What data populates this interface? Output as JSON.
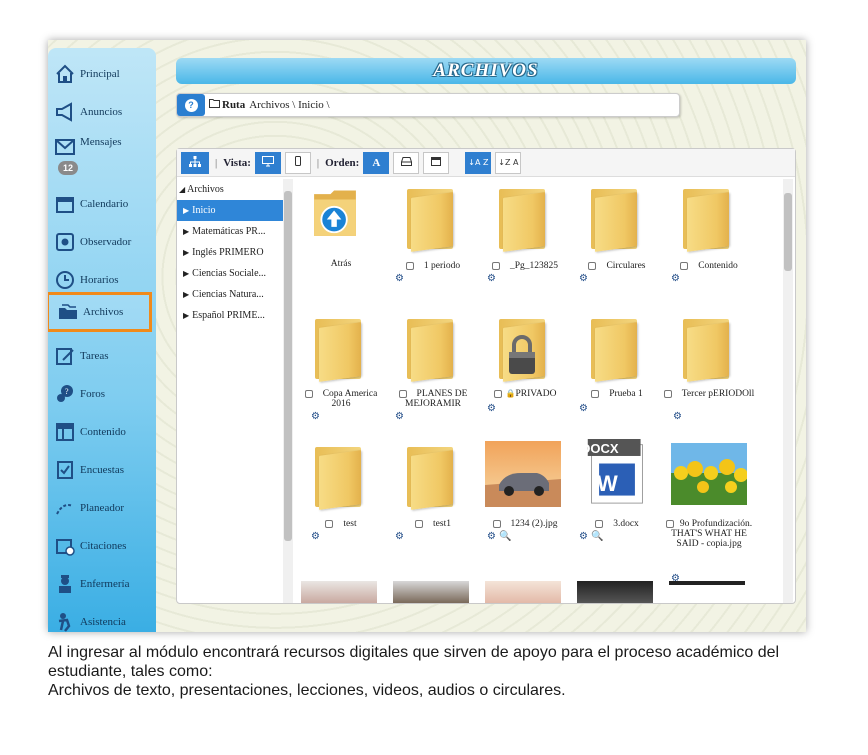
{
  "sidebar": {
    "items": [
      {
        "label": "Principal",
        "icon": "home-icon"
      },
      {
        "label": "Anuncios",
        "icon": "megaphone-icon"
      },
      {
        "label": "Mensajes",
        "icon": "envelope-icon"
      },
      {
        "label": "Calendario",
        "icon": "calendar-icon"
      },
      {
        "label": "Observador",
        "icon": "observer-icon"
      },
      {
        "label": "Horarios",
        "icon": "clock-icon"
      },
      {
        "label": "Archivos",
        "icon": "folders-icon"
      },
      {
        "label": "Tareas",
        "icon": "tasks-icon"
      },
      {
        "label": "Foros",
        "icon": "forum-icon"
      },
      {
        "label": "Contenido",
        "icon": "content-icon"
      },
      {
        "label": "Encuestas",
        "icon": "survey-icon"
      },
      {
        "label": "Planeador",
        "icon": "planner-icon"
      },
      {
        "label": "Citaciones",
        "icon": "citation-icon"
      },
      {
        "label": "Enfermería",
        "icon": "nurse-icon"
      },
      {
        "label": "Asistencia",
        "icon": "attendance-icon"
      }
    ],
    "messages_badge": "12",
    "active_color": "#f08a1a"
  },
  "header": {
    "title": "ARCHIVOS"
  },
  "breadcrumb": {
    "help": "?",
    "label": "Ruta",
    "path": "Archivos \\ Inicio \\"
  },
  "toolbar": {
    "view_label": "Vista:",
    "order_label": "Orden:",
    "order_alpha": "A",
    "sort_asc": "↓A Z",
    "sort_desc": "↓Z A"
  },
  "tree": {
    "root": "Archivos",
    "items": [
      "Inicio",
      "Matemáticas PR...",
      "Inglés PRIMERO",
      "Ciencias Sociale...",
      "Ciencias Natura...",
      "Español PRIME..."
    ],
    "selected": "Inicio"
  },
  "files": [
    {
      "name": "Atrás",
      "kind": "back"
    },
    {
      "name": "1 periodo",
      "kind": "folder"
    },
    {
      "name": "_Pg_123825",
      "kind": "folder"
    },
    {
      "name": "Circulares",
      "kind": "folder"
    },
    {
      "name": "Contenido",
      "kind": "folder"
    },
    {
      "name": "Copa America 2016",
      "kind": "folder"
    },
    {
      "name": "PLANES DE MEJORAMIR",
      "kind": "folder"
    },
    {
      "name": "PRIVADO",
      "kind": "locked"
    },
    {
      "name": "Prueba 1",
      "kind": "folder"
    },
    {
      "name": "Tercer pERIODOll",
      "kind": "folder"
    },
    {
      "name": "test",
      "kind": "folder"
    },
    {
      "name": "test1",
      "kind": "folder"
    },
    {
      "name": "1234 (2).jpg",
      "kind": "image-car"
    },
    {
      "name": "3.docx",
      "kind": "docx"
    },
    {
      "name": "9o Profundización. THAT'S WHAT HE SAID - copia.jpg",
      "kind": "image-tulips"
    }
  ],
  "docx_label": "DOCX",
  "caption": {
    "line1": "Al ingresar al módulo encontrará recursos digitales que sirven de apoyo para el proceso académico del estudiante, tales como:",
    "line2": "Archivos de texto, presentaciones, lecciones, videos, audios o circulares."
  }
}
